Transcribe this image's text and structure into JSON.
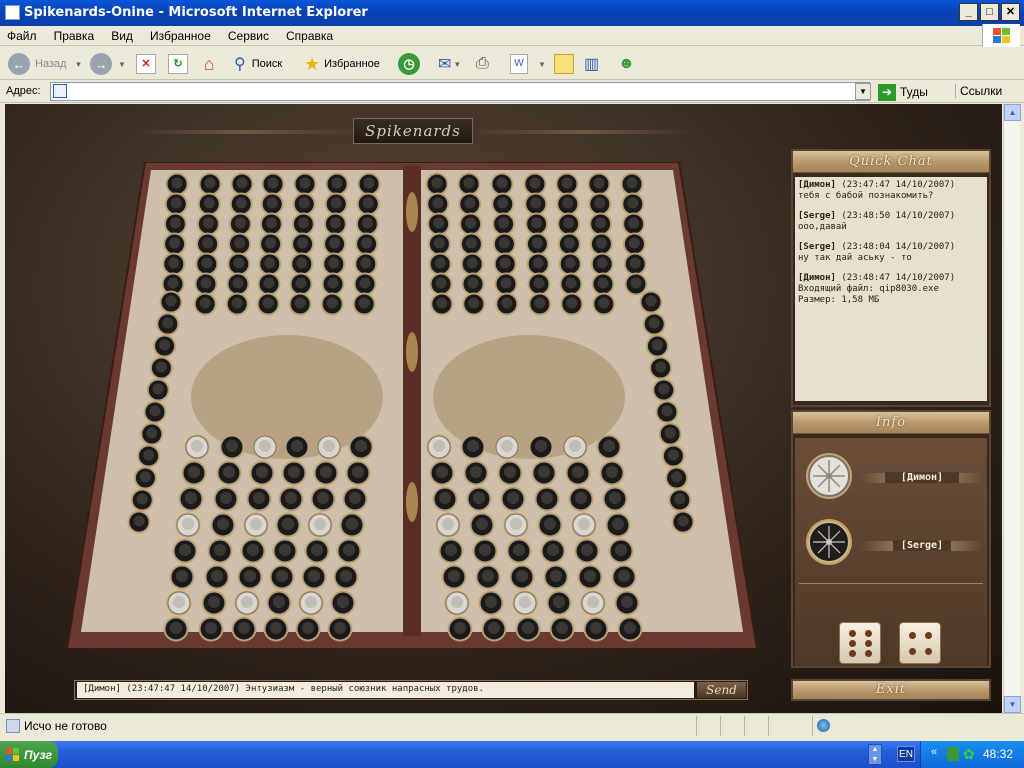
{
  "window": {
    "title": "Spikenards-Onine - Microsoft Internet Explorer",
    "buttons": [
      "_",
      "□",
      "✕"
    ]
  },
  "menu": [
    "Файл",
    "Правка",
    "Вид",
    "Избранное",
    "Сервис",
    "Справка"
  ],
  "toolbar": {
    "back_label": "Назад",
    "search_label": "Поиск",
    "favorites_label": "Избранное"
  },
  "address": {
    "label": "Адрес:",
    "value": "",
    "go_label": "Туды",
    "links_label": "Ссылки"
  },
  "status": {
    "text": "Исчо не готово"
  },
  "taskbar": {
    "start_label": "Пузг",
    "lang": "EN",
    "clock": "48:32"
  },
  "game": {
    "logo": "Spikenards",
    "quick_chat_title": "Quick Chat",
    "info_title": "Info",
    "exit_label": "Exit",
    "send_label": "Send",
    "chat_input": "[Димон] (23:47:47 14/10/2007) Энтузиазм - верный союзник напрасных трудов.",
    "chat_messages": [
      {
        "user": "[Димон]",
        "time": " (23:47:47 14/10/2007)",
        "text": "тебя с бабой познакомить?"
      },
      {
        "user": "[Serge]",
        "time": " (23:48:50 14/10/2007)",
        "text": "ооо,давай"
      },
      {
        "user": "[Serge]",
        "time": " (23:48:04 14/10/2007)",
        "text": "ну так дай аську - то"
      },
      {
        "user": "[Димон]",
        "time": " (23:48:47 14/10/2007)",
        "text": "Входящий файл: qip8030.exe",
        "text2": "Размер: 1,58 МБ"
      }
    ],
    "players": [
      {
        "name": "[Димон]",
        "piece": "white"
      },
      {
        "name": "[Serge]",
        "piece": "black"
      }
    ],
    "dice": [
      6,
      4
    ],
    "colors": {
      "board_frame": "#6a3a30",
      "board_marble": "#cdbfa9",
      "checker_dark": "#1a1a1a",
      "checker_light": "#d9d6d0"
    }
  }
}
